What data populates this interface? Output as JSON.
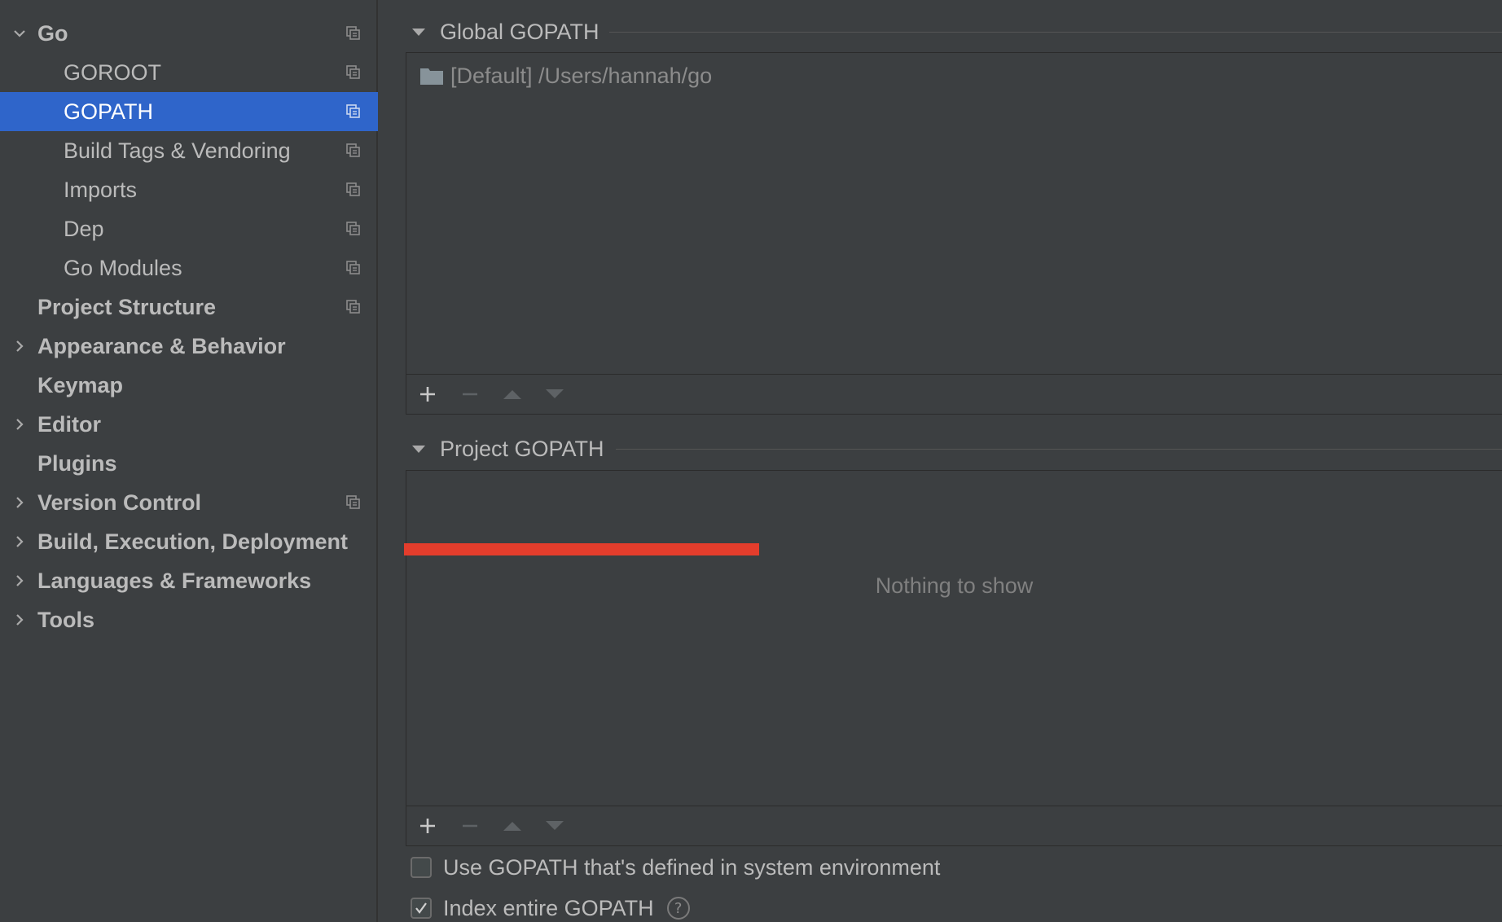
{
  "sidebar": {
    "items": [
      {
        "label": "Go",
        "arrow": "chevron-down-icon"
      },
      {
        "label": "GOROOT"
      },
      {
        "label": "GOPATH"
      },
      {
        "label": "Build Tags & Vendoring"
      },
      {
        "label": "Imports"
      },
      {
        "label": "Dep"
      },
      {
        "label": "Go Modules"
      },
      {
        "label": "Project Structure"
      },
      {
        "label": "Appearance & Behavior",
        "arrow": "chevron-right-icon"
      },
      {
        "label": "Keymap"
      },
      {
        "label": "Editor",
        "arrow": "chevron-right-icon"
      },
      {
        "label": "Plugins"
      },
      {
        "label": "Version Control",
        "arrow": "chevron-right-icon"
      },
      {
        "label": "Build, Execution, Deployment",
        "arrow": "chevron-right-icon"
      },
      {
        "label": "Languages & Frameworks",
        "arrow": "chevron-right-icon"
      },
      {
        "label": "Tools",
        "arrow": "chevron-right-icon"
      }
    ],
    "selected": "GOPATH"
  },
  "main": {
    "global_gopath": {
      "title": "Global GOPATH",
      "entries": [
        "[Default] /Users/hannah/go"
      ]
    },
    "project_gopath": {
      "title": "Project GOPATH",
      "empty_text": "Nothing to show"
    },
    "toolbar_icons": [
      "add-icon",
      "remove-icon",
      "move-up-icon",
      "move-down-icon"
    ],
    "options": {
      "use_system_gopath": {
        "label": "Use GOPATH that's defined in system environment",
        "checked": false
      },
      "index_entire_gopath": {
        "label": "Index entire GOPATH",
        "checked": true,
        "help": "?"
      }
    }
  },
  "colors": {
    "background": "#3c3f41",
    "selection": "#2f65ca",
    "text": "#bbbbbb",
    "marker": "#e43d2c"
  }
}
